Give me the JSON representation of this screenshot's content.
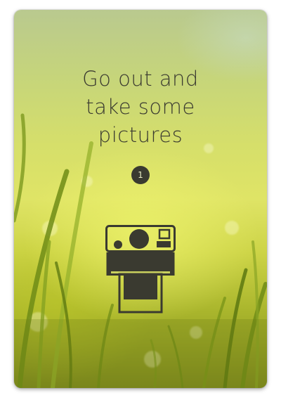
{
  "card": {
    "title_lines": [
      "Go out and",
      "take some",
      "pictures"
    ],
    "step_number": "1",
    "icon": "instant-camera-icon",
    "colors": {
      "text": "#3a3a30",
      "badge_bg": "#3a3a30",
      "badge_text": "#e8ebc4",
      "background_accent": "#dfe466"
    }
  }
}
